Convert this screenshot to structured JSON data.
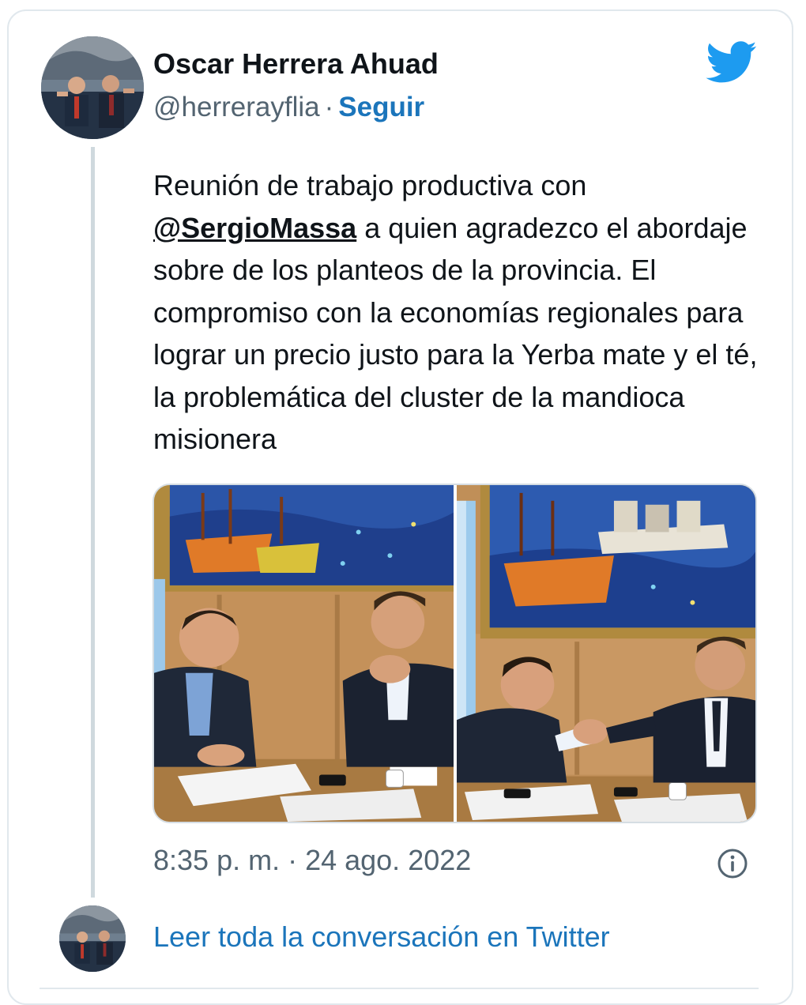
{
  "author": {
    "name": "Oscar Herrera Ahuad",
    "handle": "@herrerayflia",
    "separator": "·",
    "follow_label": "Seguir"
  },
  "tweet": {
    "text_before_mention": "Reunión de trabajo productiva con ",
    "mention": "@SergioMassa",
    "text_after_mention": " a quien agradezco el abordaje sobre de los planteos de la provincia. El compromiso con la economías regionales para lograr un precio justo para la Yerba mate y el té, la problemática del cluster de la mandioca misionera",
    "timestamp": "8:35 p. m. · 24 ago. 2022"
  },
  "footer": {
    "read_more_label": "Leer toda la conversación en Twitter"
  },
  "colors": {
    "link": "#1b75bb",
    "twitter_blue": "#1d9bf0",
    "secondary_text": "#536471",
    "border": "#e1e8ed"
  },
  "icons": [
    "twitter-bird-icon",
    "info-icon"
  ]
}
